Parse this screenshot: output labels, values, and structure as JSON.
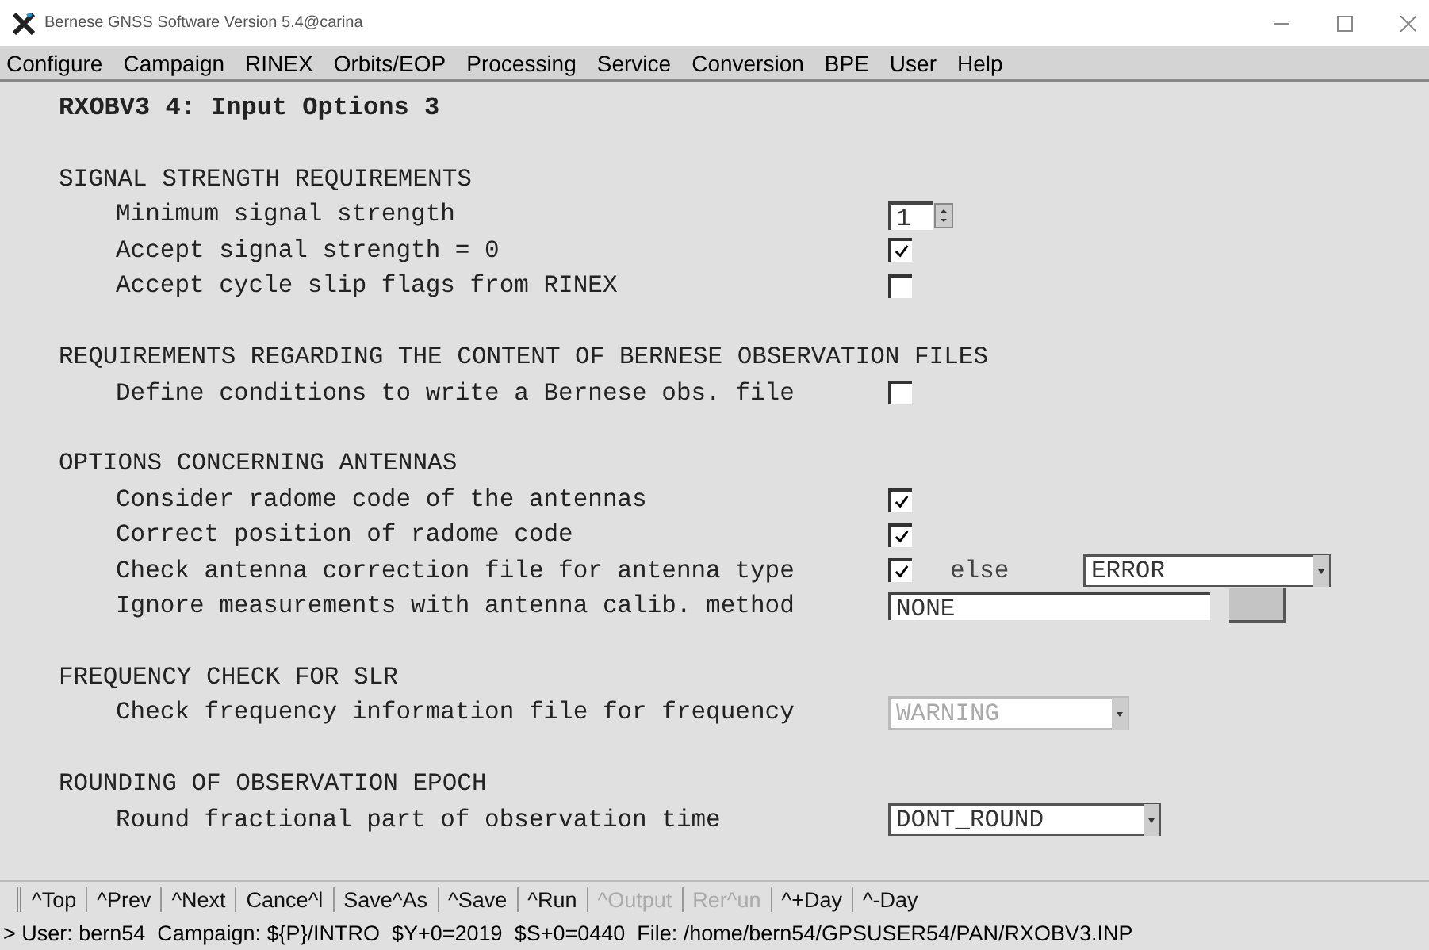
{
  "window": {
    "title": "Bernese GNSS Software Version 5.4@carina"
  },
  "menu": [
    "Configure",
    "Campaign",
    "RINEX",
    "Orbits/EOP",
    "Processing",
    "Service",
    "Conversion",
    "BPE",
    "User",
    "Help"
  ],
  "panel": {
    "title": "RXOBV3 4: Input Options 3",
    "sections": [
      {
        "title": "SIGNAL STRENGTH REQUIREMENTS",
        "rows": [
          {
            "label": "Minimum signal strength",
            "kind": "spinner",
            "value": "1"
          },
          {
            "label": "Accept signal strength = 0",
            "kind": "checkbox",
            "checked": true
          },
          {
            "label": "Accept cycle slip flags from RINEX",
            "kind": "checkbox",
            "checked": false
          }
        ]
      },
      {
        "title": "REQUIREMENTS REGARDING THE CONTENT OF BERNESE OBSERVATION FILES",
        "rows": [
          {
            "label": "Define conditions to write a Bernese obs. file",
            "kind": "checkbox",
            "checked": false
          }
        ]
      },
      {
        "title": "OPTIONS CONCERNING ANTENNAS",
        "rows": [
          {
            "label": "Consider radome code of the antennas",
            "kind": "checkbox",
            "checked": true
          },
          {
            "label": "Correct position of radome code",
            "kind": "checkbox",
            "checked": true
          },
          {
            "label": "Check antenna correction file for antenna type",
            "kind": "checkbox_select",
            "checked": true,
            "else_label": "else",
            "value": "ERROR",
            "disabled": false
          },
          {
            "label": "Ignore measurements with antenna calib. method",
            "kind": "text_button",
            "value": "NONE"
          }
        ]
      },
      {
        "title": "FREQUENCY CHECK FOR SLR",
        "rows": [
          {
            "label": "Check frequency information file for frequency",
            "kind": "select",
            "value": "WARNING",
            "disabled": true
          }
        ]
      },
      {
        "title": "ROUNDING OF OBSERVATION EPOCH",
        "rows": [
          {
            "label": "Round fractional part of observation time",
            "kind": "select",
            "value": "DONT_ROUND",
            "disabled": false
          }
        ]
      }
    ]
  },
  "toolbar": [
    {
      "label": "^Top",
      "disabled": false
    },
    {
      "label": "^Prev",
      "disabled": false
    },
    {
      "label": "^Next",
      "disabled": false
    },
    {
      "label": "Cance^l",
      "disabled": false
    },
    {
      "label": "Save^As",
      "disabled": false
    },
    {
      "label": "^Save",
      "disabled": false
    },
    {
      "label": "^Run",
      "disabled": false
    },
    {
      "label": "^Output",
      "disabled": true
    },
    {
      "label": "Rer^un",
      "disabled": true
    },
    {
      "label": "^+Day",
      "disabled": false
    },
    {
      "label": "^-Day",
      "disabled": false
    }
  ],
  "status_bar": "> User: bern54  Campaign: ${P}/INTRO  $Y+0=2019  $S+0=0440  File: /home/bern54/GPSUSER54/PAN/RXOBV3.INP"
}
